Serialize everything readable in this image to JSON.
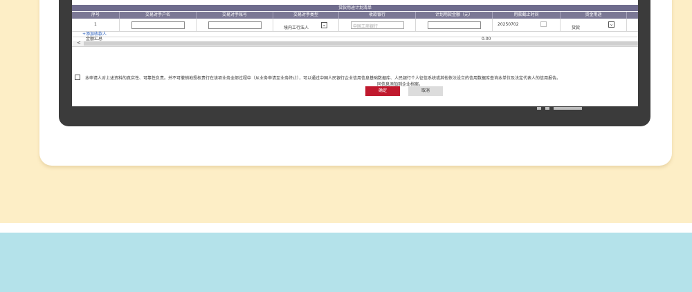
{
  "form": {
    "table_title": "贷款用途计划清单",
    "columns": [
      "序号",
      "交易对手户名",
      "交易对手账号",
      "交易对手类型",
      "收款银行",
      "计划用款金额（元）",
      "用款截止时间",
      "资金用途"
    ],
    "row": {
      "index": "1",
      "payee_name": "",
      "payee_account": "",
      "payee_type": "境内工行法人",
      "bank_placeholder": "中国工商银行",
      "amount": "",
      "deadline": "20250702",
      "fund_use": "货款"
    },
    "add_payee_link": "+添加收款人",
    "total_label": "金额汇总",
    "total_value": "0.00",
    "scroll_left": "<",
    "declaration_line1": "本申请人对上述资料的真实性、可靠性负责。并不可撤销地授权贵行在该项业务全部过程中（从业务申请至业务终止），可以通过中国人民银行企业信用信息基础数据库、人民银行个人征信系统或其他依法设立的信用数据库查询本单位及法定代表人的信用报告。",
    "declaration_line2": "同信息添加到企业档案。",
    "confirm_button": "确定",
    "cancel_button": "取消"
  },
  "colors": {
    "header": "#7b7895",
    "confirm": "#c0192e",
    "background_top": "#fdeec6",
    "background_bottom": "#b4e2ea",
    "device": "#3b3b3b"
  }
}
